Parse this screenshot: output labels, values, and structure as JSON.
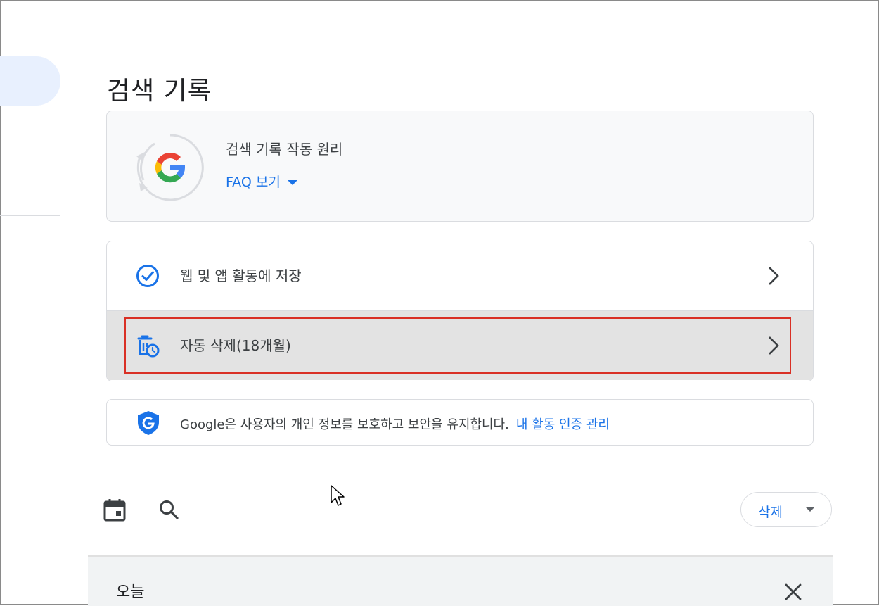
{
  "page": {
    "title": "검색 기록"
  },
  "info_card": {
    "heading": "검색 기록 작동 원리",
    "faq_label": "FAQ 보기"
  },
  "settings": {
    "items": [
      {
        "label": "웹 및 앱 활동에 저장",
        "icon": "check-circle-icon"
      },
      {
        "label": "자동 삭제(18개월)",
        "icon": "auto-delete-icon"
      }
    ]
  },
  "privacy": {
    "text": "Google은 사용자의 개인 정보를 보호하고 보안을 유지합니다.",
    "link": "내 활동 인증 관리",
    "icon": "shield-icon"
  },
  "toolbar": {
    "calendar_icon": "calendar-icon",
    "search_icon": "search-icon",
    "delete_label": "삭제"
  },
  "history": {
    "section_label": "오늘"
  },
  "colors": {
    "accent": "#1a73e8",
    "highlight_border": "#d93025",
    "selected_row_bg": "#e3e3e3",
    "card_bg": "#f8f9fa"
  }
}
